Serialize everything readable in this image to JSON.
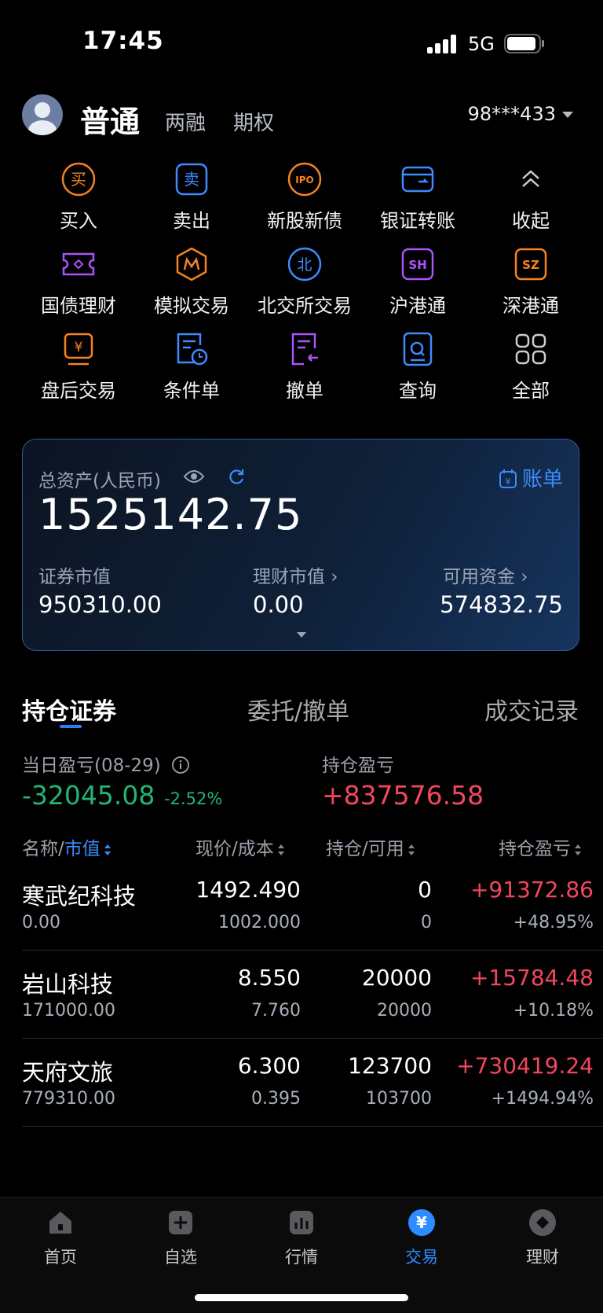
{
  "status": {
    "time": "17:45",
    "network": "5G"
  },
  "header": {
    "tabs": [
      "普通",
      "两融",
      "期权"
    ],
    "account": "98***433"
  },
  "actions": [
    {
      "label": "买入",
      "icon": "buy-icon",
      "color": "#f58220"
    },
    {
      "label": "卖出",
      "icon": "sell-icon",
      "color": "#3d8bff"
    },
    {
      "label": "新股新债",
      "icon": "ipo-icon",
      "color": "#f58220"
    },
    {
      "label": "银证转账",
      "icon": "card-transfer-icon",
      "color": "#3d8bff"
    },
    {
      "label": "收起",
      "icon": "chevron-up-icon",
      "color": "#cccccc"
    },
    {
      "label": "国债理财",
      "icon": "ticket-icon",
      "color": "#a855f7"
    },
    {
      "label": "模拟交易",
      "icon": "simulate-icon",
      "color": "#f58220"
    },
    {
      "label": "北交所交易",
      "icon": "bjs-icon",
      "color": "#3d8bff"
    },
    {
      "label": "沪港通",
      "icon": "sh-icon",
      "color": "#a855f7"
    },
    {
      "label": "深港通",
      "icon": "sz-icon",
      "color": "#f58220"
    },
    {
      "label": "盘后交易",
      "icon": "afterhours-icon",
      "color": "#f58220"
    },
    {
      "label": "条件单",
      "icon": "condition-order-icon",
      "color": "#3d8bff"
    },
    {
      "label": "撤单",
      "icon": "cancel-order-icon",
      "color": "#a855f7"
    },
    {
      "label": "查询",
      "icon": "query-icon",
      "color": "#3d8bff"
    },
    {
      "label": "全部",
      "icon": "all-grid-icon",
      "color": "#cccccc"
    }
  ],
  "assets": {
    "total_label": "总资产(人民币)",
    "total": "1525142.75",
    "bill_label": "账单",
    "securities_label": "证券市值",
    "securities": "950310.00",
    "wealth_label": "理财市值",
    "wealth": "0.00",
    "cash_label": "可用资金",
    "cash": "574832.75"
  },
  "position_tabs": [
    "持仓证券",
    "委托/撤单",
    "成交记录"
  ],
  "pnl": {
    "daily_label": "当日盈亏(08-29)",
    "daily": "-32045.08",
    "daily_pct": "-2.52%",
    "hold_label": "持仓盈亏",
    "hold": "+837576.58"
  },
  "table": {
    "headers": {
      "name": "名称/",
      "value": "市值",
      "price": "现价/成本",
      "qty": "持仓/可用",
      "pnl": "持仓盈亏"
    },
    "rows": [
      {
        "name": "寒武纪科技",
        "value": "0.00",
        "price": "1492.490",
        "cost": "1002.000",
        "hold": "0",
        "avail": "0",
        "pnl": "+91372.86",
        "pnl_pct": "+48.95%"
      },
      {
        "name": "岩山科技",
        "value": "171000.00",
        "price": "8.550",
        "cost": "7.760",
        "hold": "20000",
        "avail": "20000",
        "pnl": "+15784.48",
        "pnl_pct": "+10.18%"
      },
      {
        "name": "天府文旅",
        "value": "779310.00",
        "price": "6.300",
        "cost": "0.395",
        "hold": "123700",
        "avail": "103700",
        "pnl": "+730419.24",
        "pnl_pct": "+1494.94%"
      }
    ]
  },
  "nav": [
    {
      "label": "首页",
      "icon": "home-icon"
    },
    {
      "label": "自选",
      "icon": "watchlist-plus-icon"
    },
    {
      "label": "行情",
      "icon": "market-chart-icon"
    },
    {
      "label": "交易",
      "icon": "trade-yen-icon"
    },
    {
      "label": "理财",
      "icon": "wealth-icon"
    }
  ],
  "colors": {
    "accent": "#2d8cff",
    "up": "#f1475e",
    "down": "#22b573",
    "orange": "#f58220",
    "purple": "#a855f7"
  }
}
